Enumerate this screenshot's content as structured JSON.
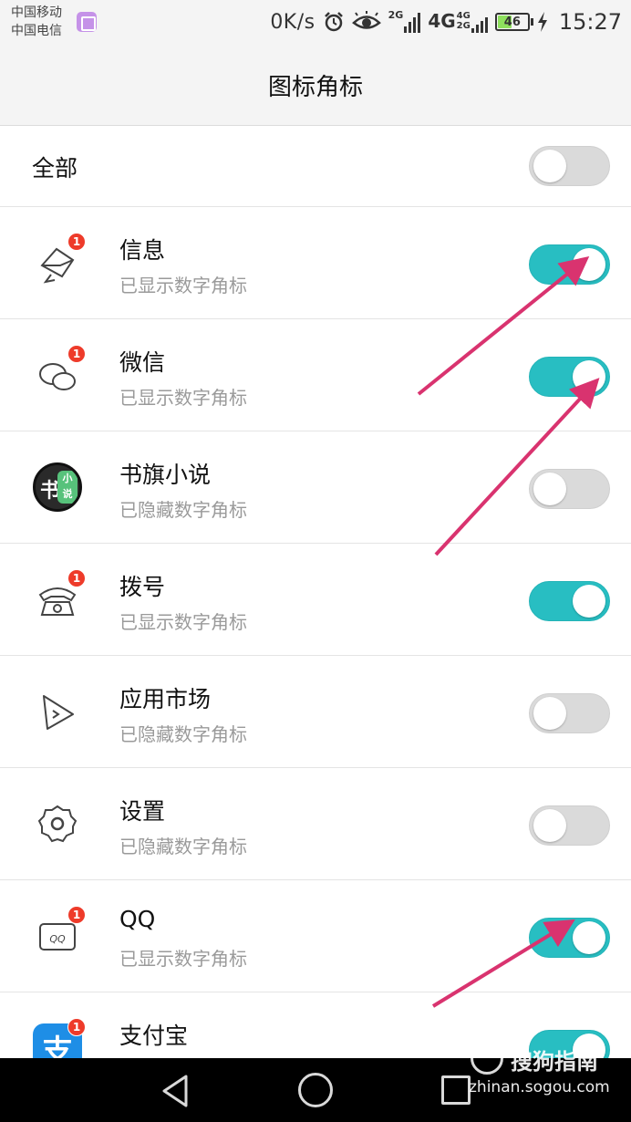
{
  "status_bar": {
    "carrier_1": "中国移动",
    "carrier_2": "中国电信",
    "net_speed": "0K/s",
    "sim1_type": "2G",
    "sim2_type_top": "4G",
    "sim2_type_mid": "4G",
    "sim2_type_bot": "2G",
    "battery": "46",
    "time": "15:27",
    "icons": [
      "alarm-icon",
      "eye-care-icon",
      "signal-icon",
      "battery-icon",
      "charging-icon"
    ]
  },
  "header": {
    "title": "图标角标"
  },
  "all_row": {
    "label": "全部",
    "enabled": false
  },
  "apps": [
    {
      "name": "信息",
      "status": "已显示数字角标",
      "enabled": true,
      "badge": "1",
      "icon": "messages-icon"
    },
    {
      "name": "微信",
      "status": "已显示数字角标",
      "enabled": true,
      "badge": "1",
      "icon": "wechat-icon"
    },
    {
      "name": "书旗小说",
      "status": "已隐藏数字角标",
      "enabled": false,
      "icon": "shuqi-novel-icon",
      "icon_text_main": "书",
      "icon_text_side_1": "小",
      "icon_text_side_2": "说"
    },
    {
      "name": "拨号",
      "status": "已显示数字角标",
      "enabled": true,
      "badge": "1",
      "icon": "phone-dialer-icon"
    },
    {
      "name": "应用市场",
      "status": "已隐藏数字角标",
      "enabled": false,
      "icon": "app-market-icon"
    },
    {
      "name": "设置",
      "status": "已隐藏数字角标",
      "enabled": false,
      "icon": "settings-gear-icon"
    },
    {
      "name": "QQ",
      "status": "已显示数字角标",
      "enabled": true,
      "badge": "1",
      "icon": "qq-icon",
      "icon_text": "QQ"
    },
    {
      "name": "支付宝",
      "status": "",
      "enabled": true,
      "badge": "1",
      "icon": "alipay-icon",
      "icon_text": "支"
    }
  ],
  "navigation": {
    "icons": [
      "back-icon",
      "home-icon",
      "recent-apps-icon"
    ]
  },
  "watermark": {
    "title": "搜狗指南",
    "url": "zhinan.sogou.com"
  },
  "colors": {
    "toggle_on": "#28bec2",
    "toggle_off": "#dadada",
    "badge": "#ee3b2a",
    "arrow": "#d9336f"
  }
}
